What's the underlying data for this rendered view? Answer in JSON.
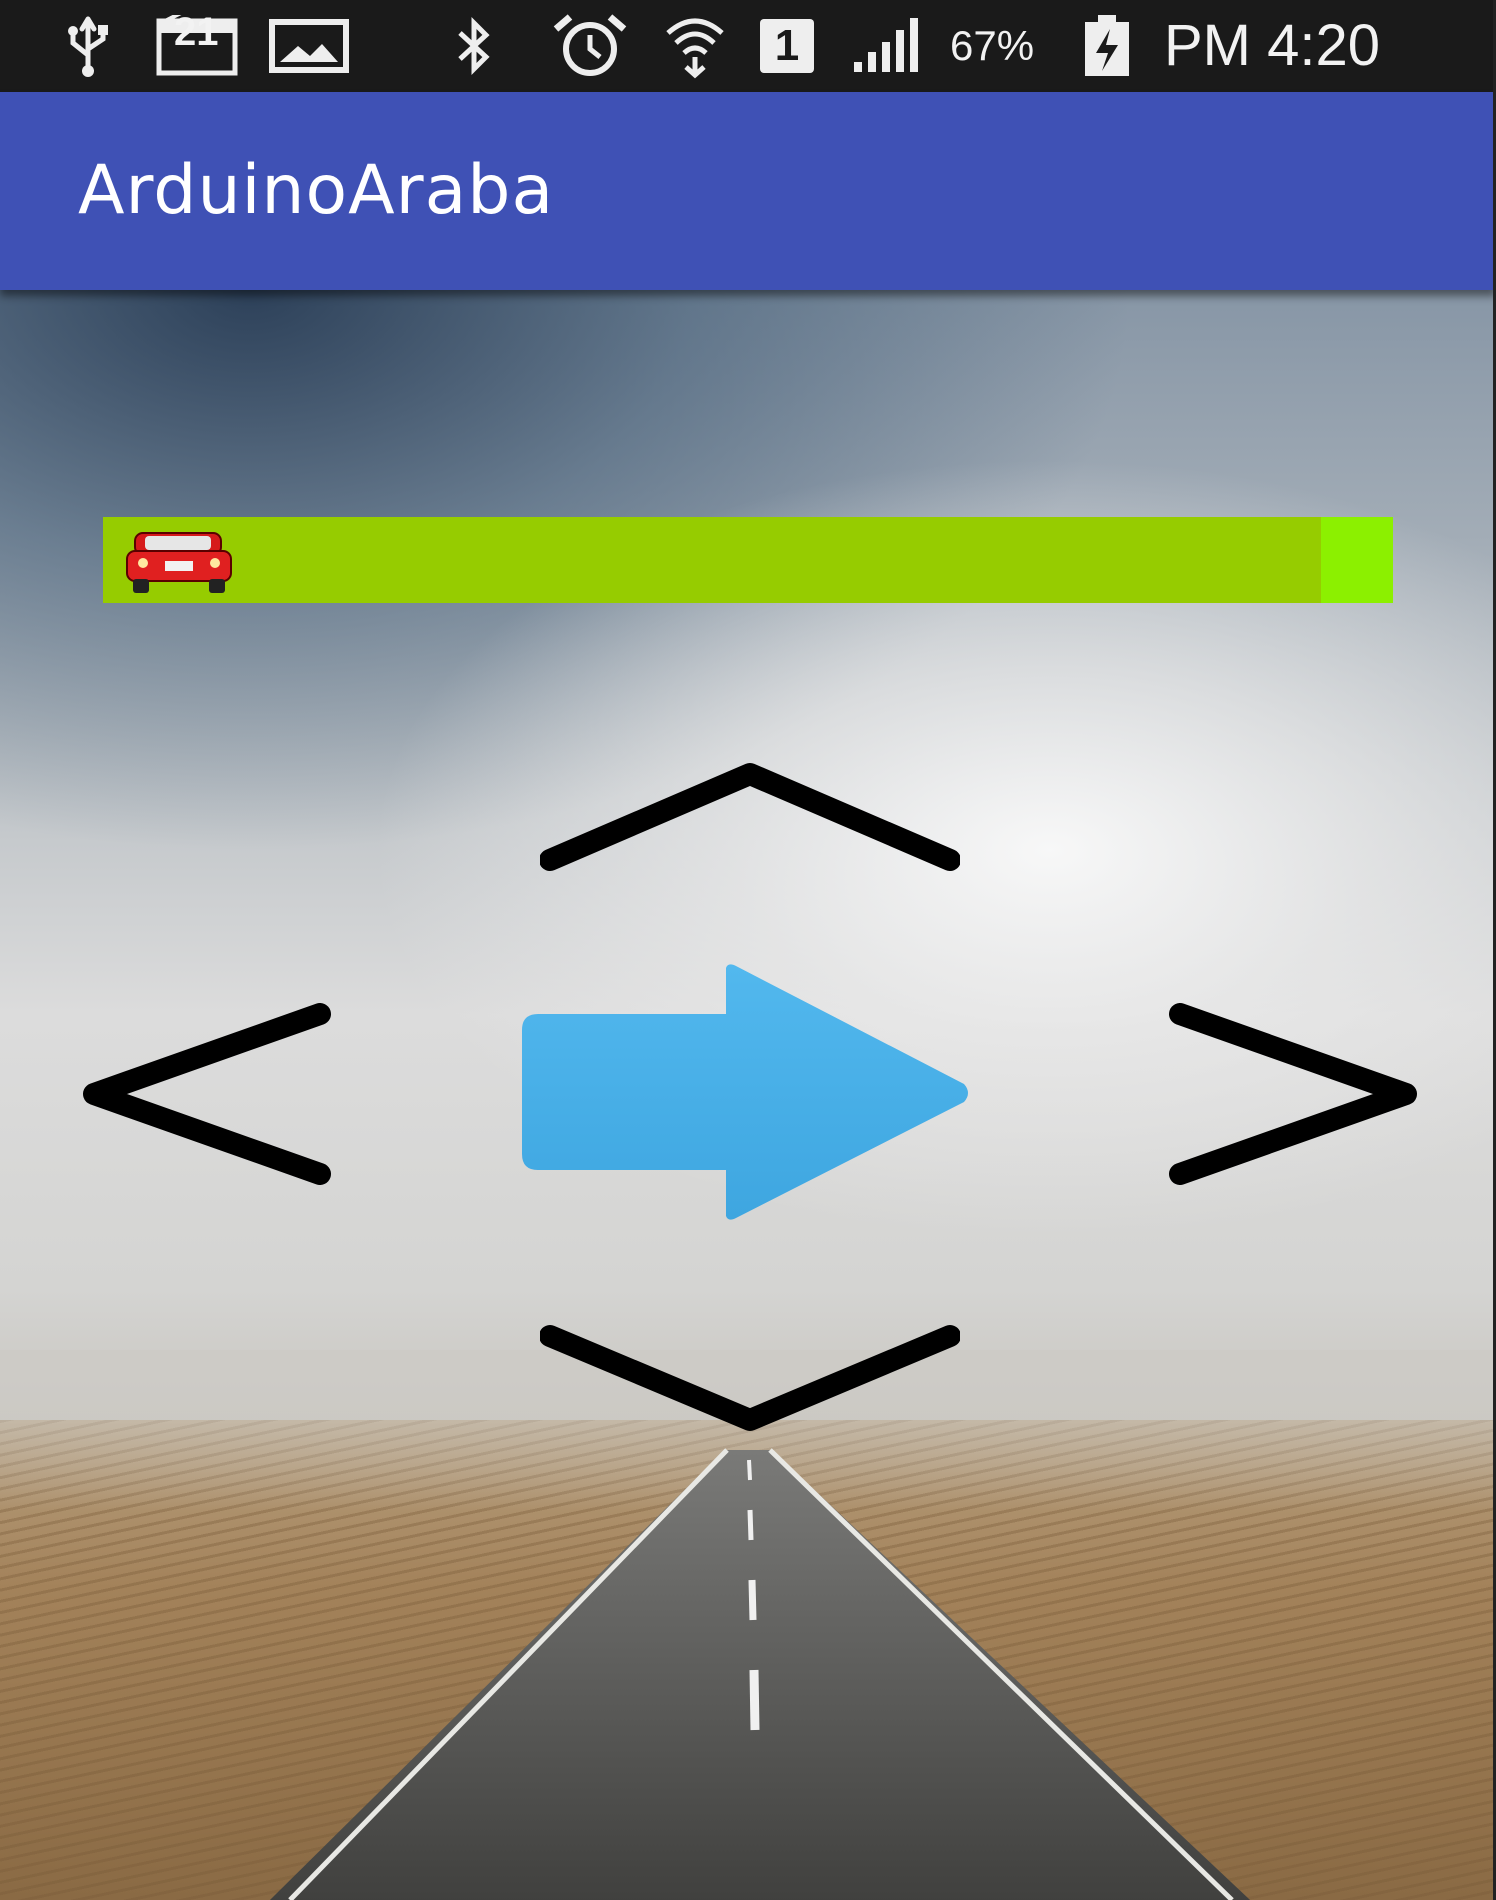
{
  "status_bar": {
    "notification_badge": "21",
    "sim_slot": "1",
    "battery": "67%",
    "time": "PM 4:20",
    "icons": [
      "usb-icon",
      "calendar-icon",
      "gallery-icon",
      "bluetooth-icon",
      "alarm-icon",
      "wifi-icon",
      "sim-icon",
      "signal-icon",
      "battery-charging-icon"
    ]
  },
  "app": {
    "title": "ArduinoAraba"
  },
  "speed_bar": {
    "value_percent": 0,
    "thumb_icon": "red-car-icon",
    "track_color": "#96cc00",
    "end_color": "#8cf000"
  },
  "controls": {
    "up_icon": "chevron-up-icon",
    "down_icon": "chevron-down-icon",
    "left_icon": "chevron-left-icon",
    "right_icon": "chevron-right-icon",
    "center_icon": "arrow-right-icon",
    "center_color": "#45aee6"
  },
  "colors": {
    "app_bar": "#3f51b5",
    "status_bar": "#1a1a1a"
  }
}
